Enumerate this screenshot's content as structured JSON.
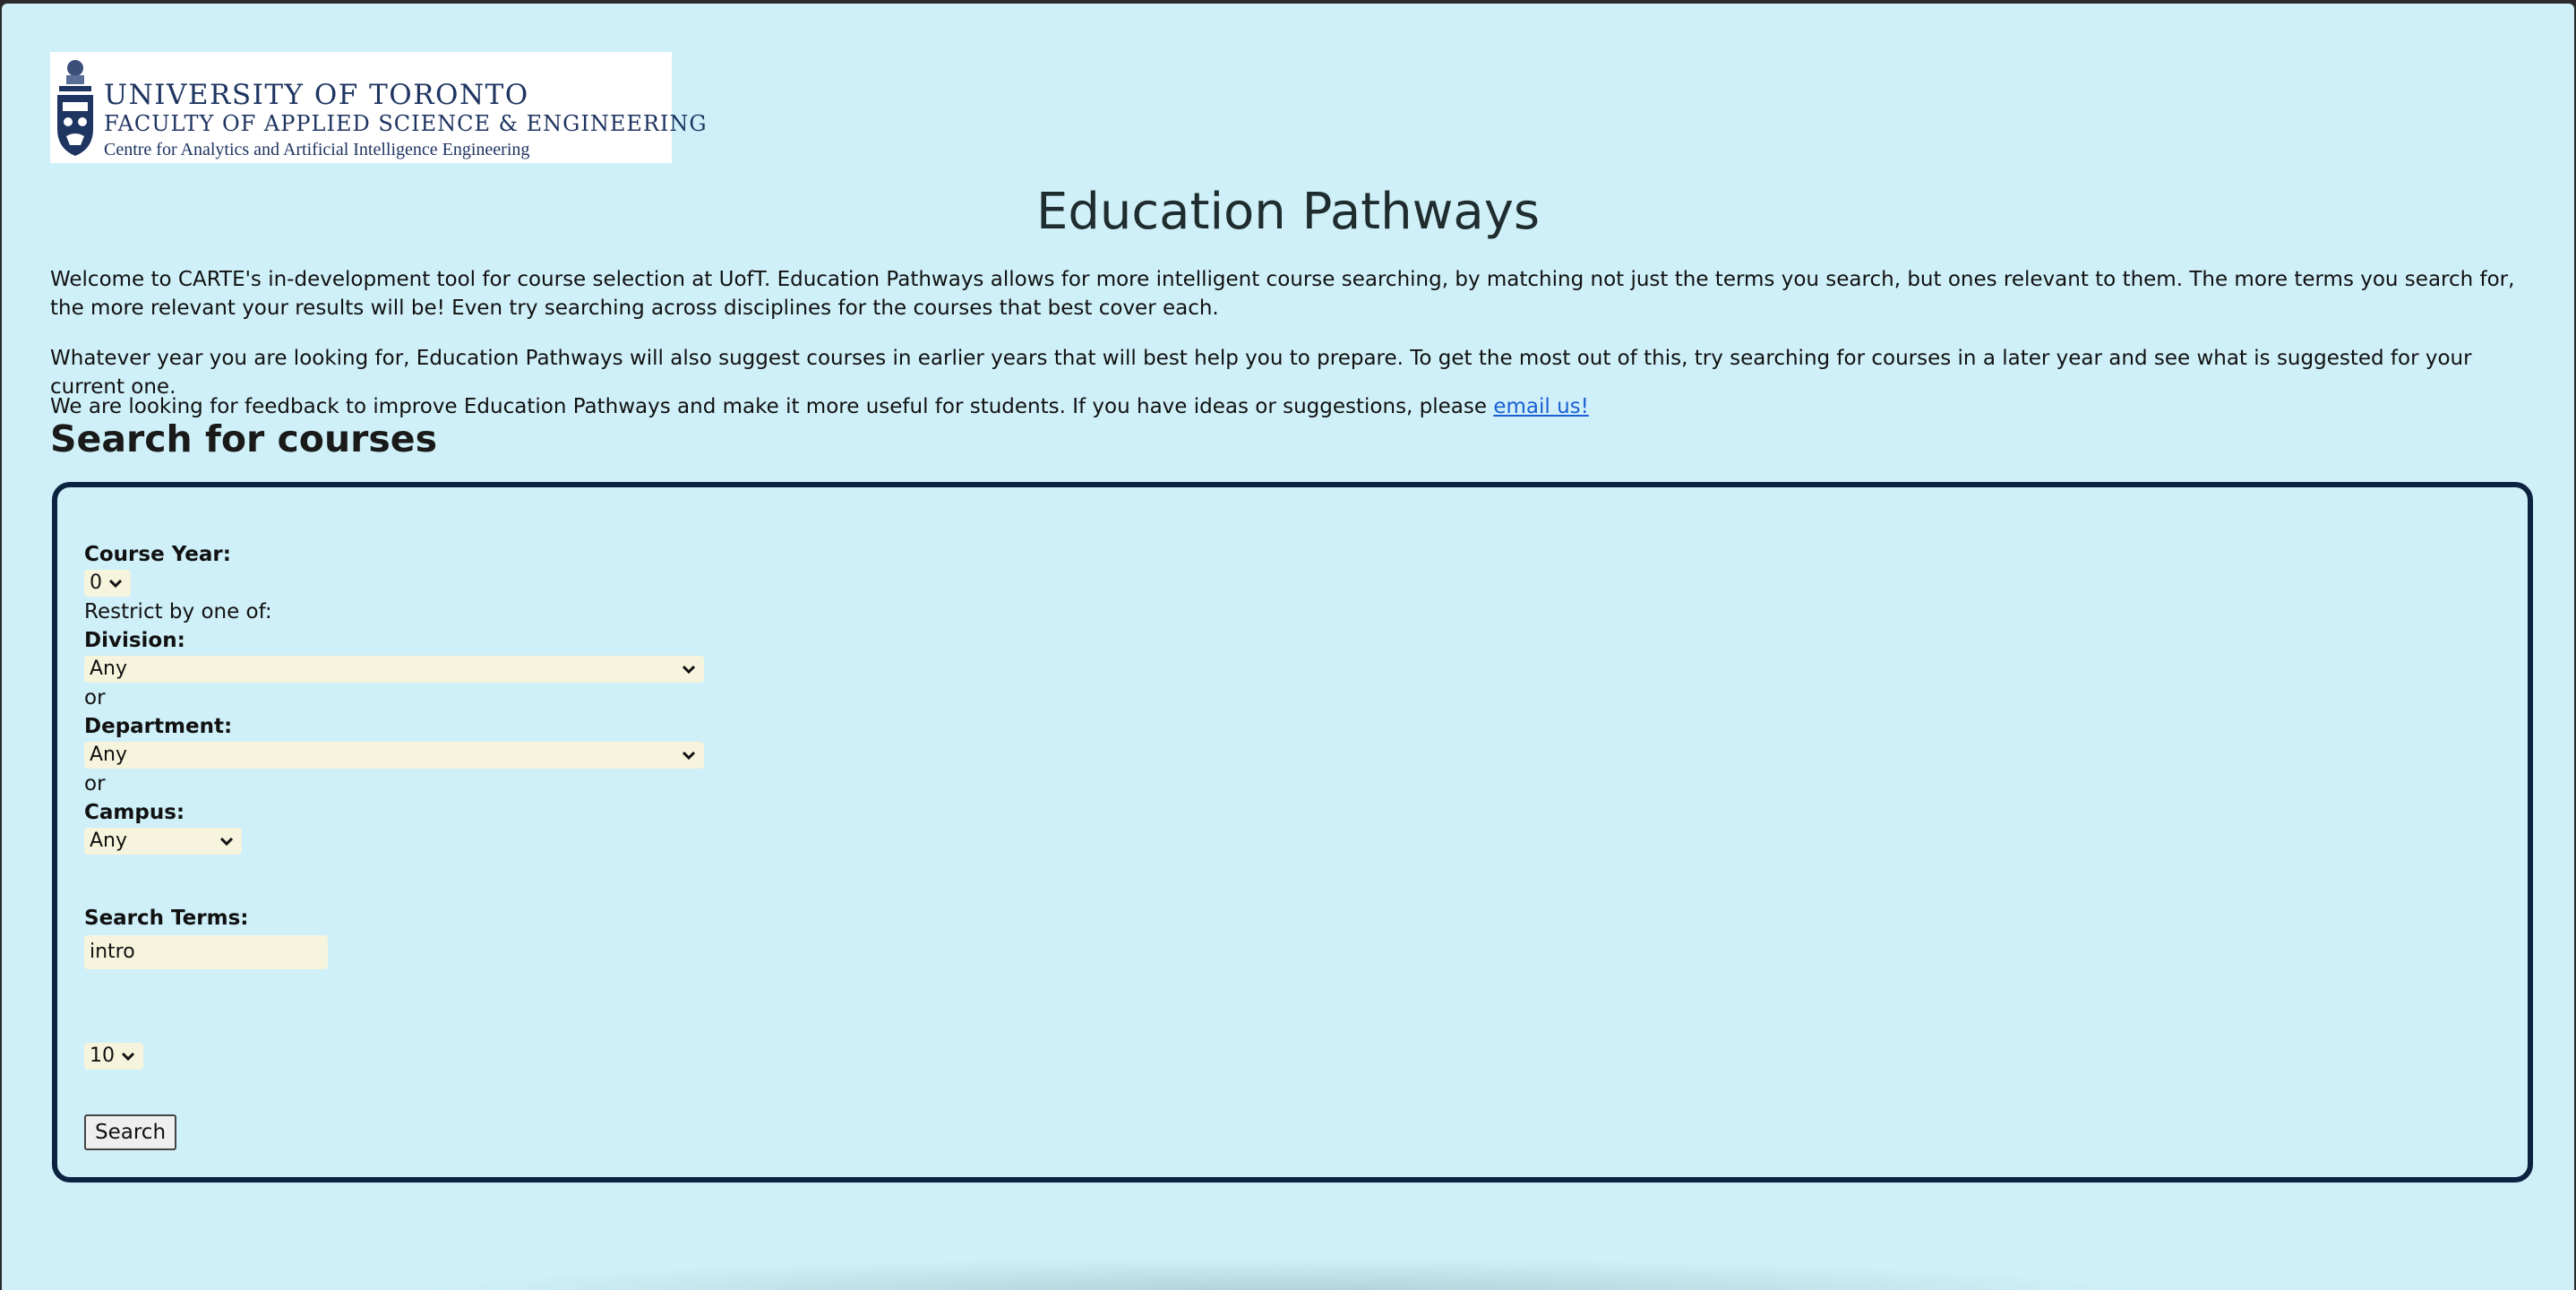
{
  "header": {
    "logo": {
      "line1": "UNIVERSITY OF TORONTO",
      "line2": "FACULTY OF APPLIED SCIENCE & ENGINEERING",
      "line3": "Centre for Analytics and Artificial Intelligence Engineering"
    },
    "title": "Education Pathways"
  },
  "intro": {
    "p1": "Welcome to CARTE's in-development tool for course selection at UofT. Education Pathways allows for more intelligent course searching, by matching not just the terms you search, but ones relevant to them. The more terms you search for, the more relevant your results will be! Even try searching across disciplines for the courses that best cover each.",
    "p2": "Whatever year you are looking for, Education Pathways will also suggest courses in earlier years that will best help you to prepare. To get the most out of this, try searching for courses in a later year and see what is suggested for your current one.",
    "p3_text": "We are looking for feedback to improve Education Pathways and make it more useful for students. If you have ideas or suggestions, please ",
    "p3_link": "email us!"
  },
  "search": {
    "section_title": "Search for courses",
    "course_year_label": "Course Year:",
    "course_year_value": "0",
    "restrict_text": "Restrict by one of:",
    "division_label": "Division:",
    "division_value": "Any",
    "or_1": "or",
    "department_label": "Department:",
    "department_value": "Any",
    "or_2": "or",
    "campus_label": "Campus:",
    "campus_value": "Any",
    "terms_label": "Search Terms:",
    "terms_value": "intro",
    "results_count_value": "10",
    "search_button": "Search"
  }
}
